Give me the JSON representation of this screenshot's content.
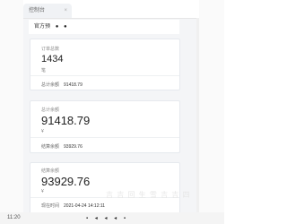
{
  "tab": {
    "label": "控制台",
    "close": "×"
  },
  "top_row": {
    "label": "官方预",
    "dots": "●  ●"
  },
  "cards": [
    {
      "title": "订单总数",
      "value": "1434",
      "unit": "笔",
      "footer_label": "总计余额",
      "footer_value": "91418.79"
    },
    {
      "title": "总计余额",
      "value": "91418.79",
      "unit": "¥",
      "footer_label": "结算余额",
      "footer_value": "93929.76"
    },
    {
      "title": "结算余额",
      "value": "93929.76",
      "unit": "¥",
      "footer_label": "现在时间",
      "footer_value": "2021-04-24 14:12:11"
    }
  ],
  "bottom": {
    "time": "11:20",
    "icons": "▪ ◂ ◂ ◂ ▪"
  },
  "watermark": "吉 吉 回 生 雪 吉 吉 四"
}
